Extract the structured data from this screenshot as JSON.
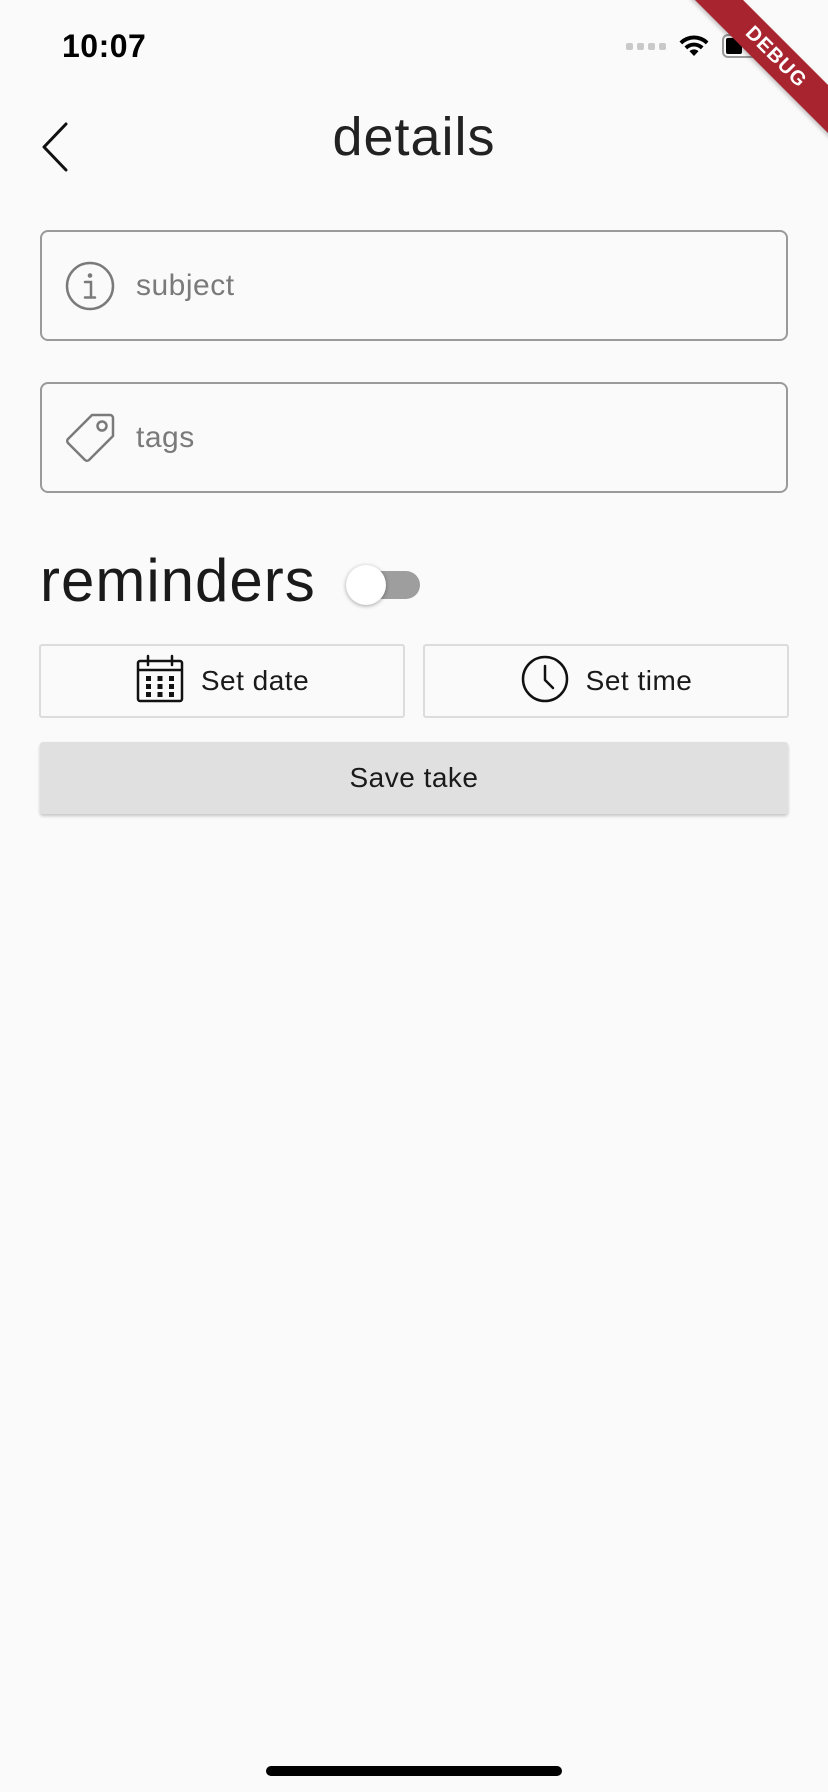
{
  "status_bar": {
    "time": "10:07",
    "debug_label": "DEBUG"
  },
  "header": {
    "title": "details",
    "back_icon": "chevron-left-icon"
  },
  "form": {
    "subject": {
      "placeholder": "subject",
      "value": "",
      "icon": "info-icon"
    },
    "tags": {
      "placeholder": "tags",
      "value": "",
      "icon": "tag-icon"
    }
  },
  "reminders": {
    "label": "reminders",
    "enabled": false
  },
  "buttons": {
    "set_date": {
      "label": "Set date",
      "icon": "calendar-icon"
    },
    "set_time": {
      "label": "Set time",
      "icon": "clock-icon"
    },
    "save": {
      "label": "Save take"
    }
  },
  "colors": {
    "background": "#fafafa",
    "field_border": "#9a9a9a",
    "save_button_bg": "#e0e0e0",
    "toggle_track_off": "#9e9e9e",
    "debug_ribbon": "#a8242f"
  }
}
